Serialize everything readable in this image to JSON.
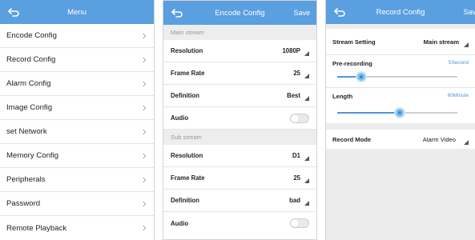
{
  "colors": {
    "header": "#5a9fe0",
    "accent": "#4f95db"
  },
  "menu_screen": {
    "title": "Menu",
    "items": [
      {
        "label": "Encode Config"
      },
      {
        "label": "Record Config"
      },
      {
        "label": "Alarm Config"
      },
      {
        "label": "Image Config"
      },
      {
        "label": "set Network"
      },
      {
        "label": "Memory Config"
      },
      {
        "label": "Peripherals"
      },
      {
        "label": "Password"
      },
      {
        "label": "Remote Playback"
      }
    ]
  },
  "encode_screen": {
    "title": "Encode Config",
    "save_label": "Save",
    "main_stream": {
      "section_label": "Main stream",
      "resolution_label": "Resolution",
      "resolution_value": "1080P",
      "frame_rate_label": "Frame Rate",
      "frame_rate_value": "25",
      "definition_label": "Definition",
      "definition_value": "Best",
      "audio_label": "Audio",
      "audio_on": false
    },
    "sub_stream": {
      "section_label": "Sub stream",
      "resolution_label": "Resolution",
      "resolution_value": "D1",
      "frame_rate_label": "Frame Rate",
      "frame_rate_value": "25",
      "definition_label": "Definition",
      "definition_value": "bad",
      "audio_label": "Audio",
      "audio_on": false
    }
  },
  "record_screen": {
    "title": "Record Config",
    "save_label": "Save",
    "stream_setting_label": "Stream Setting",
    "stream_setting_value": "Main stream",
    "prerecording_label": "Pre-recording",
    "prerecording_value": "5Second",
    "prerecording_level": 0.2,
    "length_label": "Length",
    "length_value": "60Minute",
    "length_level": 0.52,
    "record_mode_label": "Record Mode",
    "record_mode_value": "Alarm Video"
  }
}
